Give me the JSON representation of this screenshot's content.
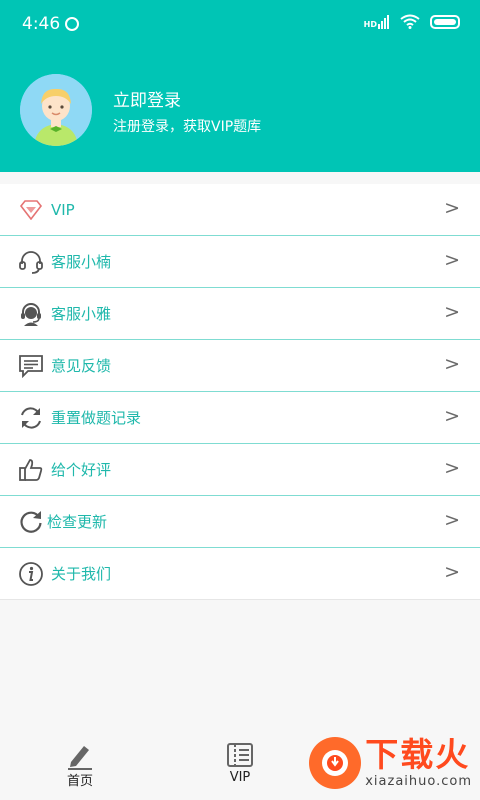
{
  "status_bar": {
    "time": "4:46",
    "network": "HD"
  },
  "profile": {
    "title": "立即登录",
    "subtitle": "注册登录，获取VIP题库"
  },
  "menu": [
    {
      "label": "VIP",
      "icon": "diamond-icon"
    },
    {
      "label": "客服小楠",
      "icon": "headset-icon"
    },
    {
      "label": "客服小雅",
      "icon": "support-agent-icon"
    },
    {
      "label": "意见反馈",
      "icon": "feedback-icon"
    },
    {
      "label": "重置做题记录",
      "icon": "refresh-icon"
    },
    {
      "label": "给个好评",
      "icon": "thumbs-up-icon"
    },
    {
      "label": "检查更新",
      "icon": "update-icon"
    },
    {
      "label": "关于我们",
      "icon": "info-icon"
    }
  ],
  "arrow": ">",
  "tabs": [
    {
      "label": "首页",
      "icon": "pencil-icon"
    },
    {
      "label": "VIP",
      "icon": "ticket-icon"
    }
  ],
  "watermark": {
    "big": "下载火",
    "small": "xiazaihuo.com"
  },
  "colors": {
    "accent": "#00c5b5",
    "label": "#1fb8ab",
    "divider": "#7fdcd2",
    "watermark": "#ff4a1e"
  }
}
